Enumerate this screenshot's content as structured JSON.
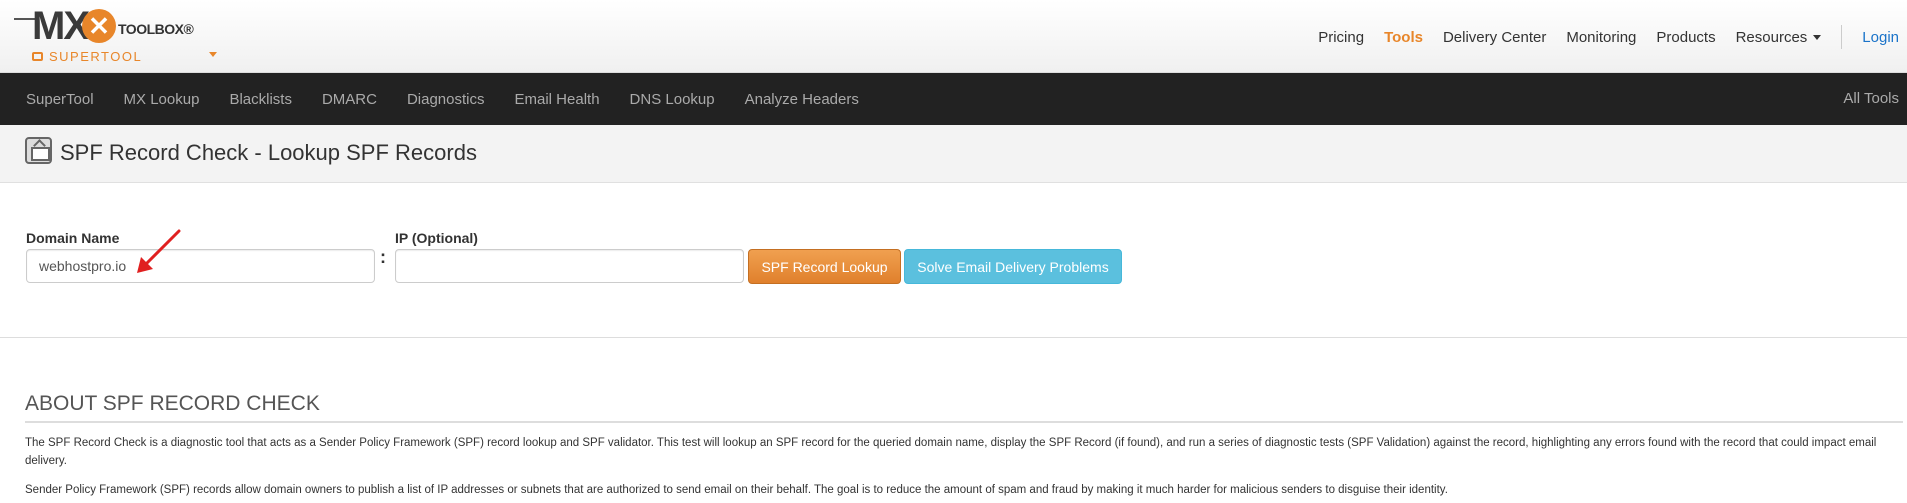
{
  "header": {
    "logo": {
      "brand_mx": "MX",
      "brand_toolbox": "TOOLBOX®",
      "product": "SUPERTOOL"
    },
    "nav": [
      {
        "label": "Pricing"
      },
      {
        "label": "Tools"
      },
      {
        "label": "Delivery Center"
      },
      {
        "label": "Monitoring"
      },
      {
        "label": "Products"
      },
      {
        "label": "Resources"
      }
    ],
    "login": "Login"
  },
  "toolnav": {
    "items": [
      "SuperTool",
      "MX Lookup",
      "Blacklists",
      "DMARC",
      "Diagnostics",
      "Email Health",
      "DNS Lookup",
      "Analyze Headers"
    ],
    "all_tools": "All Tools"
  },
  "page": {
    "title": "SPF Record Check - Lookup SPF Records"
  },
  "form": {
    "domain_label": "Domain Name",
    "domain_value": "webhostpro.io",
    "ip_label": "IP (Optional)",
    "ip_value": "",
    "separator": ":",
    "lookup_button": "SPF Record Lookup",
    "solve_button": "Solve Email Delivery Problems"
  },
  "about": {
    "heading": "ABOUT SPF RECORD CHECK",
    "p1": "The SPF Record Check is a diagnostic tool that acts as a Sender Policy Framework (SPF) record lookup and SPF validator. This test will lookup an SPF record for the queried domain name, display the SPF Record (if found), and run a series of diagnostic tests (SPF Validation) against the record, highlighting any errors found with the record that could impact email delivery.",
    "p2": "Sender Policy Framework (SPF) records allow domain owners to publish a list of IP addresses or subnets that are authorized to send email on their behalf.  The goal is to reduce the amount of spam and fraud by making it much harder for malicious senders to disguise their identity."
  },
  "colors": {
    "accent": "#e8862a",
    "darknav": "#222222",
    "info": "#5bc0de",
    "link": "#1a73c9",
    "annotation": "#e02020"
  }
}
